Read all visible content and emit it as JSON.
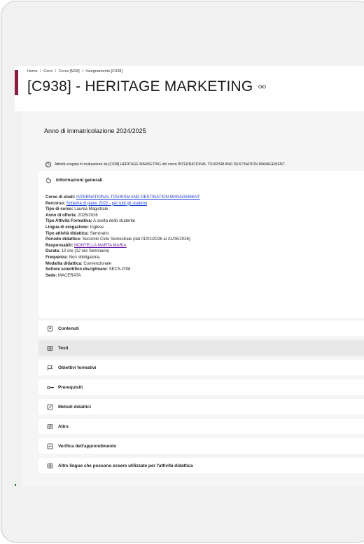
{
  "breadcrumb": {
    "items": [
      "Home",
      "/",
      "Corsi",
      "/",
      "Corso [M28]",
      "/",
      "Insegnamento [C938]"
    ]
  },
  "page": {
    "title": "[C938] - HERITAGE MARKETING",
    "year": "Anno di immatricolazione 2024/2025"
  },
  "notice": {
    "text": "Attività erogata in mutuazione da [C938] HERITAGE MARKETING del corso INTERNATIONAL TOURISM AND DESTINATION MANAGEMENT"
  },
  "general_info": {
    "title": "Informazioni generali",
    "fields": [
      {
        "label": "Corso di studi:",
        "value": "INTERNATIONAL TOURISM AND DESTINATION MANAGEMENT",
        "link": true
      },
      {
        "label": "Percorso:",
        "value": "Schema di piano 2022 - per tutti gli studenti",
        "link": true
      },
      {
        "label": "Tipo di corso:",
        "value": "Laurea Magistrale"
      },
      {
        "label": "Anno di offerta:",
        "value": "2025/2026"
      },
      {
        "label": "Tipo Attività Formativa:",
        "value": "A scelta dello studente"
      },
      {
        "label": "Lingua di erogazione:",
        "value": "Inglese"
      },
      {
        "label": "Tipo attività didattica:",
        "value": "Seminario"
      },
      {
        "label": "Periodo didattico:",
        "value": "Secondo Ciclo Semestrale (dal 01/02/2026 al 31/05/2026)"
      },
      {
        "label": "Responsabili:",
        "value": "MONTELLA MARTA MARIA",
        "link": true,
        "visited": true
      },
      {
        "label": "Durata:",
        "value": "12 ore (12 ore Seminario)"
      },
      {
        "label": "Frequenza:",
        "value": "Non obbligatoria"
      },
      {
        "label": "Modalita didattica:",
        "value": "Convenzionale"
      },
      {
        "label": "Settore scientifico disciplinare:",
        "value": "SECS-P/08"
      },
      {
        "label": "Sede:",
        "value": "MACERATA"
      }
    ]
  },
  "sections": [
    {
      "label": "Contenuti",
      "icon": "document-icon"
    },
    {
      "label": "Testi",
      "icon": "book-icon",
      "active": true
    },
    {
      "label": "Obiettivi formativi",
      "icon": "flag-icon"
    },
    {
      "label": "Prerequisiti",
      "icon": "key-icon"
    },
    {
      "label": "Metodi didattici",
      "icon": "edit-note-icon"
    },
    {
      "label": "Altro",
      "icon": "book-icon"
    },
    {
      "label": "Verifica dell'apprendimento",
      "icon": "checklist-icon"
    },
    {
      "label": "Altre lingue che possono essere utilizzate per l'attività didattica",
      "icon": "book-icon"
    }
  ]
}
